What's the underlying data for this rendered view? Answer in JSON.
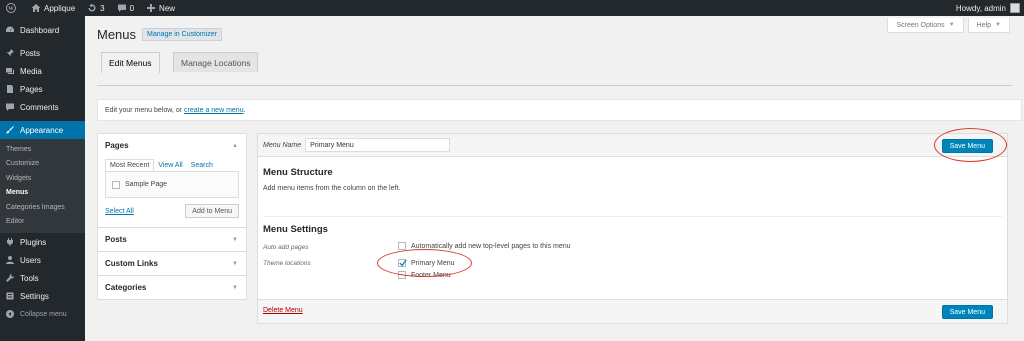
{
  "adminbar": {
    "site_name": "Applique",
    "updates_count": "3",
    "comments_count": "0",
    "new_label": "New",
    "howdy": "Howdy, admin"
  },
  "sidebar": {
    "dashboard": "Dashboard",
    "posts": "Posts",
    "media": "Media",
    "pages": "Pages",
    "comments": "Comments",
    "appearance": "Appearance",
    "sub": [
      "Themes",
      "Customize",
      "Widgets",
      "Menus",
      "Categories Images",
      "Editor"
    ],
    "plugins": "Plugins",
    "users": "Users",
    "tools": "Tools",
    "settings": "Settings",
    "collapse": "Collapse menu"
  },
  "header": {
    "screen_options": "Screen Options",
    "help": "Help",
    "title": "Menus",
    "manage_customizer": "Manage in Customizer"
  },
  "tabs": {
    "edit_menus": "Edit Menus",
    "manage_locations": "Manage Locations"
  },
  "notice": {
    "text": "Edit your menu below, or",
    "link": "create a new menu",
    "end": "."
  },
  "left": {
    "pages_title": "Pages",
    "inner_tabs": [
      "Most Recent",
      "View All",
      "Search"
    ],
    "sample_page": "Sample Page",
    "select_all": "Select All",
    "add_to_menu": "Add to Menu",
    "posts_title": "Posts",
    "custom_links_title": "Custom Links",
    "categories_title": "Categories"
  },
  "editor": {
    "menu_name_label": "Menu Name",
    "menu_name_value": "Primary Menu",
    "save_menu": "Save Menu",
    "structure_title": "Menu Structure",
    "structure_text": "Add menu items from the column on the left.",
    "settings_title": "Menu Settings",
    "auto_add_label": "Auto add pages",
    "auto_add_option": "Automatically add new top-level pages to this menu",
    "theme_locations_label": "Theme locations",
    "primary_menu": "Primary Menu",
    "footer_menu": "Footer Menu",
    "delete_menu": "Delete Menu"
  },
  "colors": {
    "admin_dark": "#23282d",
    "active_blue": "#0073aa",
    "primary_button": "#0085ba",
    "annotation_red": "#d93a2b"
  }
}
